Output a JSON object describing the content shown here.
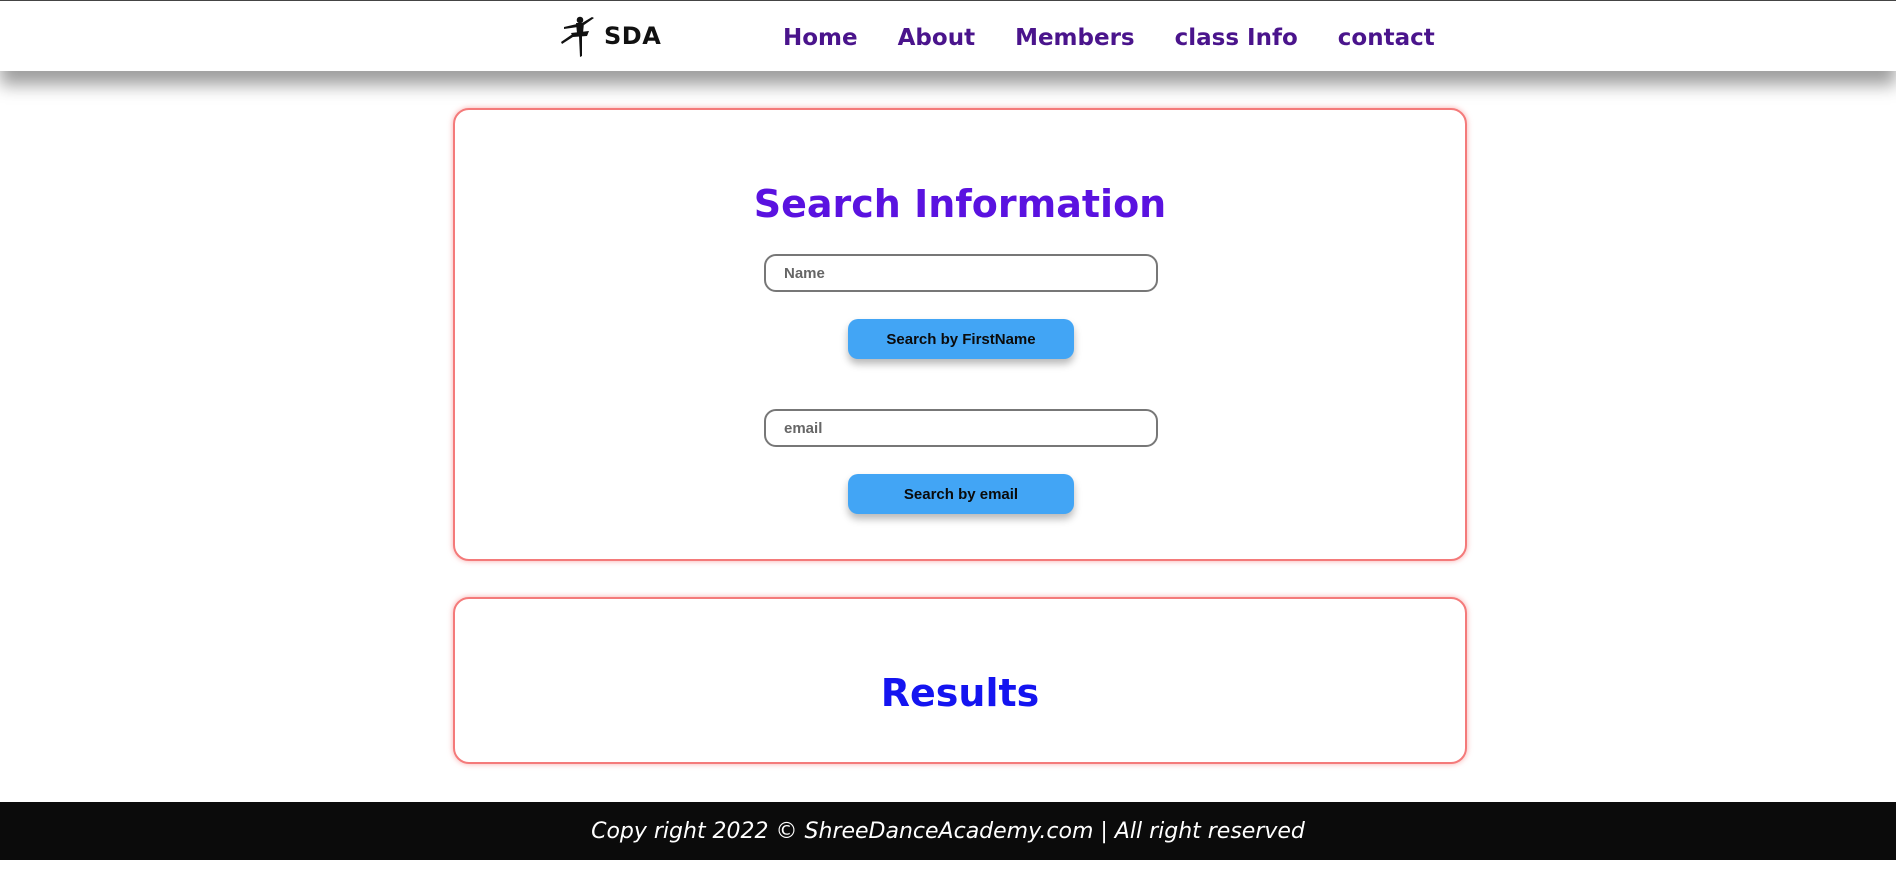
{
  "navbar": {
    "brand": {
      "logo_icon": "ballerina-silhouette-icon",
      "name": "SDA"
    },
    "links": [
      {
        "label": "Home"
      },
      {
        "label": "About"
      },
      {
        "label": "Members"
      },
      {
        "label": "class Info"
      },
      {
        "label": "contact"
      }
    ],
    "link_color": "#4a148c"
  },
  "search_card": {
    "title": "Search Information",
    "title_color": "#5a12e0",
    "name_input": {
      "placeholder": "Name",
      "value": ""
    },
    "name_button_label": "Search by FirstName",
    "email_input": {
      "placeholder": "email",
      "value": ""
    },
    "email_button_label": "Search by email",
    "button_color": "#42a5f5",
    "border_color": "#f47a7a"
  },
  "results_card": {
    "title": "Results",
    "title_color": "#1414f0"
  },
  "footer": {
    "text": "Copy right 2022 © ShreeDanceAcademy.com | All right reserved",
    "background": "#0b0b0b"
  }
}
